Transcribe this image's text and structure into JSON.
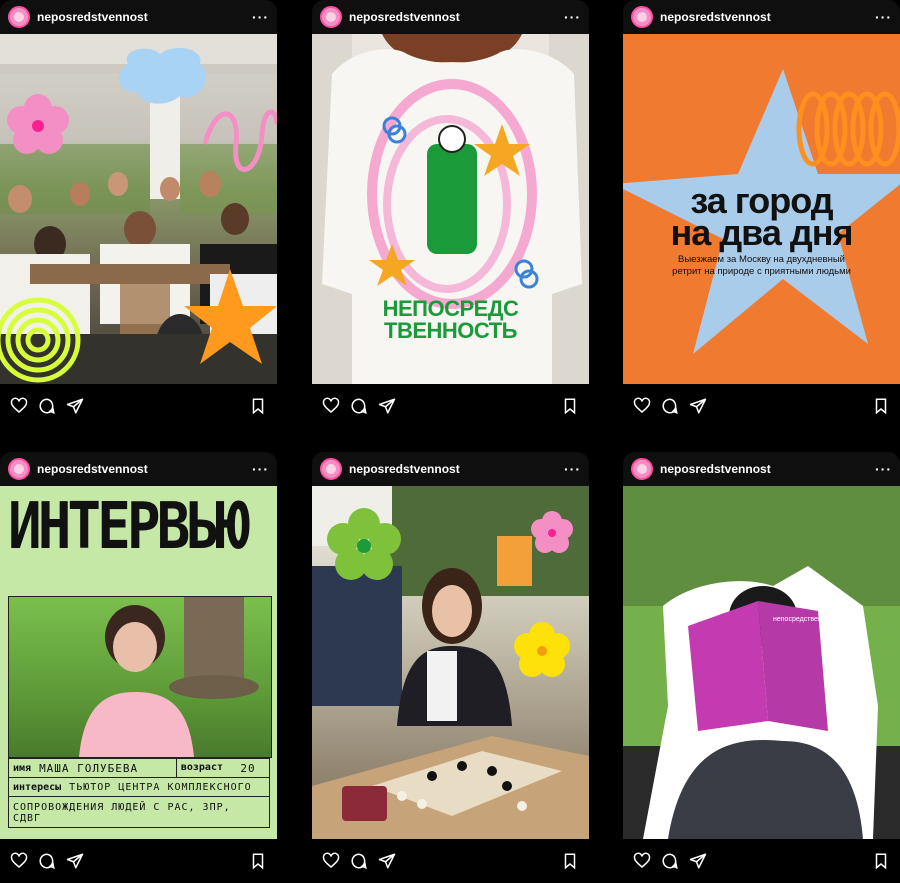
{
  "username": "neposredstvennost",
  "more_label": "···",
  "colors": {
    "accent_pink": "#ff4f9f",
    "green": "#1b9a3a",
    "orange": "#f07a2f",
    "light_green": "#c5e8a6"
  },
  "post3": {
    "title_line1": "за город",
    "title_line2": "на два дня",
    "subtitle_line1": "Выезжаем за Москву на двухдневный",
    "subtitle_line2": "ретрит на природе с приятными людьми"
  },
  "post2": {
    "tee_line1": "НЕПОСРЕДС",
    "tee_line2": "ТВЕННОСТЬ"
  },
  "post4": {
    "heading": "ИНТЕРВЬЮ",
    "name_label": "имя",
    "name_value": "МАША ГОЛУБЕВА",
    "age_label": "возраст",
    "age_value": "20",
    "interests_label": "интересы",
    "interests_value_line1": "ТЬЮТОР ЦЕНТРА КОМПЛЕКСНОГО",
    "interests_value_line2": "СОПРОВОЖДЕНИЯ ЛЮДЕЙ С РАС, ЗПР, СДВГ"
  },
  "post6": {
    "magazine_label": "непосредственность"
  },
  "icons": [
    "heart-icon",
    "comment-icon",
    "share-icon",
    "bookmark-icon",
    "more-icon"
  ]
}
